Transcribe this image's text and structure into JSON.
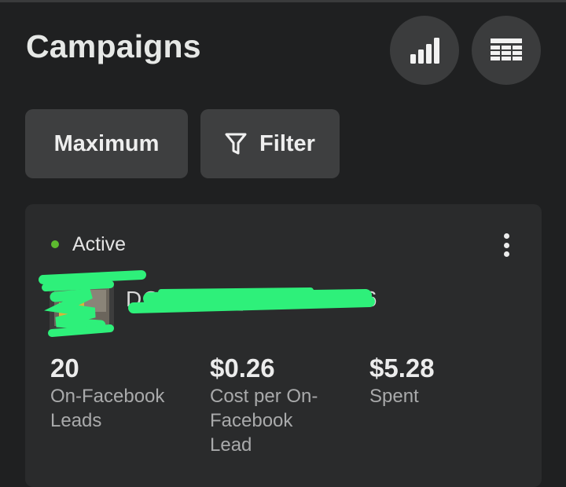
{
  "header": {
    "title": "Campaigns",
    "chart_icon": "bar-chart-icon",
    "table_icon": "table-icon"
  },
  "toolbar": {
    "maximum_label": "Maximum",
    "filter_label": "Filter",
    "filter_icon": "funnel-icon"
  },
  "campaign": {
    "status": "Active",
    "status_color": "#5dbb2f",
    "name": "DOG_____LYING 12.06",
    "menu_icon": "more-vertical-icon",
    "metrics": [
      {
        "value": "20",
        "label": "On-Facebook Leads"
      },
      {
        "value": "$0.26",
        "label": "Cost per On-Facebook Lead"
      },
      {
        "value": "$5.28",
        "label": "Spent"
      }
    ]
  },
  "colors": {
    "background": "#1f2021",
    "card": "#2a2b2c",
    "button": "#3e3f40",
    "redaction": "#2ef07a"
  }
}
